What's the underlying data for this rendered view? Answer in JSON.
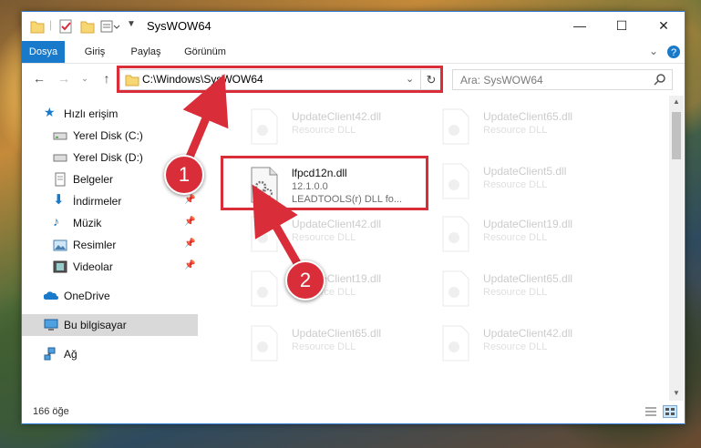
{
  "window": {
    "title": "SysWOW64",
    "controls": {
      "minimize": "—",
      "maximize": "☐",
      "close": "✕"
    }
  },
  "ribbon": {
    "tabs": [
      {
        "label": "Dosya",
        "active": true
      },
      {
        "label": "Giriş"
      },
      {
        "label": "Paylaş"
      },
      {
        "label": "Görünüm"
      }
    ]
  },
  "nav": {
    "address": "C:\\Windows\\SysWOW64",
    "search_placeholder": "Ara: SysWOW64"
  },
  "sidebar": {
    "items": [
      {
        "label": "Hızlı erişim",
        "icon": "star-icon"
      },
      {
        "label": "Yerel Disk (C:)",
        "icon": "drive-icon"
      },
      {
        "label": "Yerel Disk (D:)",
        "icon": "drive-icon"
      },
      {
        "label": "Belgeler",
        "icon": "documents-icon"
      },
      {
        "label": "İndirmeler",
        "icon": "downloads-icon",
        "pinned": true
      },
      {
        "label": "Müzik",
        "icon": "music-icon",
        "pinned": true
      },
      {
        "label": "Resimler",
        "icon": "pictures-icon",
        "pinned": true
      },
      {
        "label": "Videolar",
        "icon": "videos-icon",
        "pinned": true
      },
      {
        "label": "OneDrive",
        "icon": "onedrive-icon"
      },
      {
        "label": "Bu bilgisayar",
        "icon": "computer-icon",
        "selected": true
      },
      {
        "label": "Ağ",
        "icon": "network-icon"
      }
    ]
  },
  "files": {
    "highlighted": {
      "name": "lfpcd12n.dll",
      "version": "12.1.0.0",
      "description": "LEADTOOLS(r) DLL fo..."
    },
    "faded": [
      {
        "name": "UpdateClient42.dll",
        "type": "Resource DLL"
      },
      {
        "name": "UpdateClient65.dll",
        "type": "Resource DLL"
      },
      {
        "name": "UpdateClient5.dll",
        "type": "Resource DLL"
      },
      {
        "name": "UpdateClient42.dll",
        "type": "Resource DLL"
      },
      {
        "name": "UpdateClient19.dll",
        "type": "Resource DLL"
      },
      {
        "name": "UpdateClient19.dll",
        "type": "Resource DLL"
      },
      {
        "name": "UpdateClient65.dll",
        "type": "Resource DLL"
      },
      {
        "name": "UpdateClient65.dll",
        "type": "Resource DLL"
      },
      {
        "name": "UpdateClient42.dll",
        "type": "Resource DLL"
      }
    ]
  },
  "status": {
    "count": "166 öğe"
  },
  "callouts": [
    "1",
    "2"
  ],
  "colors": {
    "accent": "#1979ca",
    "callout": "#d92e3a"
  }
}
